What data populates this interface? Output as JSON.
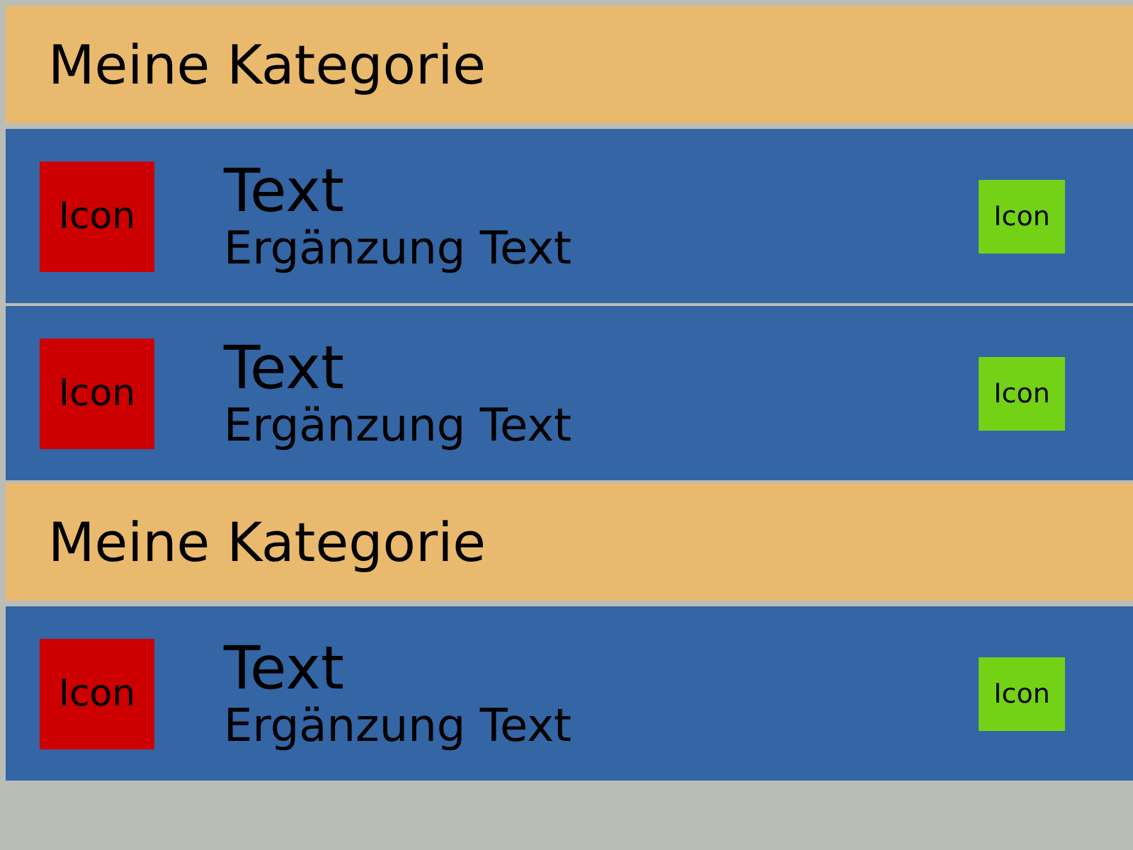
{
  "sections": [
    {
      "title": "Meine Kategorie",
      "items": [
        {
          "text": "Text",
          "subtext": "Ergänzung Text",
          "left_icon": "Icon",
          "right_icon": "Icon"
        },
        {
          "text": "Text",
          "subtext": "Ergänzung Text",
          "left_icon": "Icon",
          "right_icon": "Icon"
        }
      ]
    },
    {
      "title": "Meine Kategorie",
      "items": [
        {
          "text": "Text",
          "subtext": "Ergänzung Text",
          "left_icon": "Icon",
          "right_icon": "Icon"
        }
      ]
    }
  ]
}
